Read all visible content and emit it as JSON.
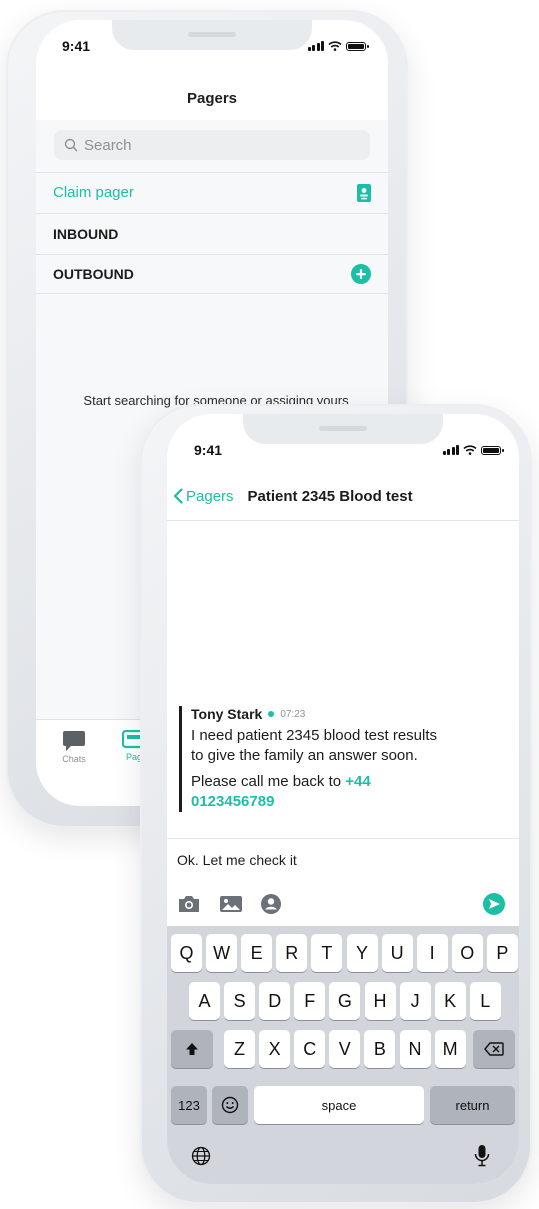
{
  "colors": {
    "accent": "#1bbfa6",
    "text": "#1c1c1c",
    "muted": "#8d9196"
  },
  "phone1": {
    "status_time": "9:41",
    "title": "Pagers",
    "search_placeholder": "Search",
    "rows": [
      {
        "label": "Claim pager",
        "icon": "id-badge-icon"
      },
      {
        "label": "INBOUND"
      },
      {
        "label": "OUTBOUND",
        "icon": "plus-circle-icon"
      }
    ],
    "empty_state": "Start searching for someone or assiging yours",
    "tabs": [
      {
        "label": "Chats",
        "icon": "chat-bubble-icon"
      },
      {
        "label": "Pag",
        "icon": "pager-icon"
      }
    ]
  },
  "phone2": {
    "status_time": "9:41",
    "back_label": "Pagers",
    "title": "Patient 2345 Blood test",
    "message": {
      "author": "Tony Stark",
      "time": "07:23",
      "line1": "I need patient 2345 blood test results",
      "line2": "to give the family an answer soon.",
      "callback_text": "Please call me back to ",
      "phone_part1": "+44",
      "phone_part2": "0123456789"
    },
    "reply_text": "Ok. Let me check it",
    "attach_icons": [
      "camera-icon",
      "image-icon",
      "contact-icon"
    ],
    "keyboard": {
      "row1": [
        "Q",
        "W",
        "E",
        "R",
        "T",
        "Y",
        "U",
        "I",
        "O",
        "P"
      ],
      "row2": [
        "A",
        "S",
        "D",
        "F",
        "G",
        "H",
        "J",
        "K",
        "L"
      ],
      "row3": [
        "Z",
        "X",
        "C",
        "V",
        "B",
        "N",
        "M"
      ],
      "num_key": "123",
      "space_key": "space",
      "return_key": "return"
    }
  }
}
